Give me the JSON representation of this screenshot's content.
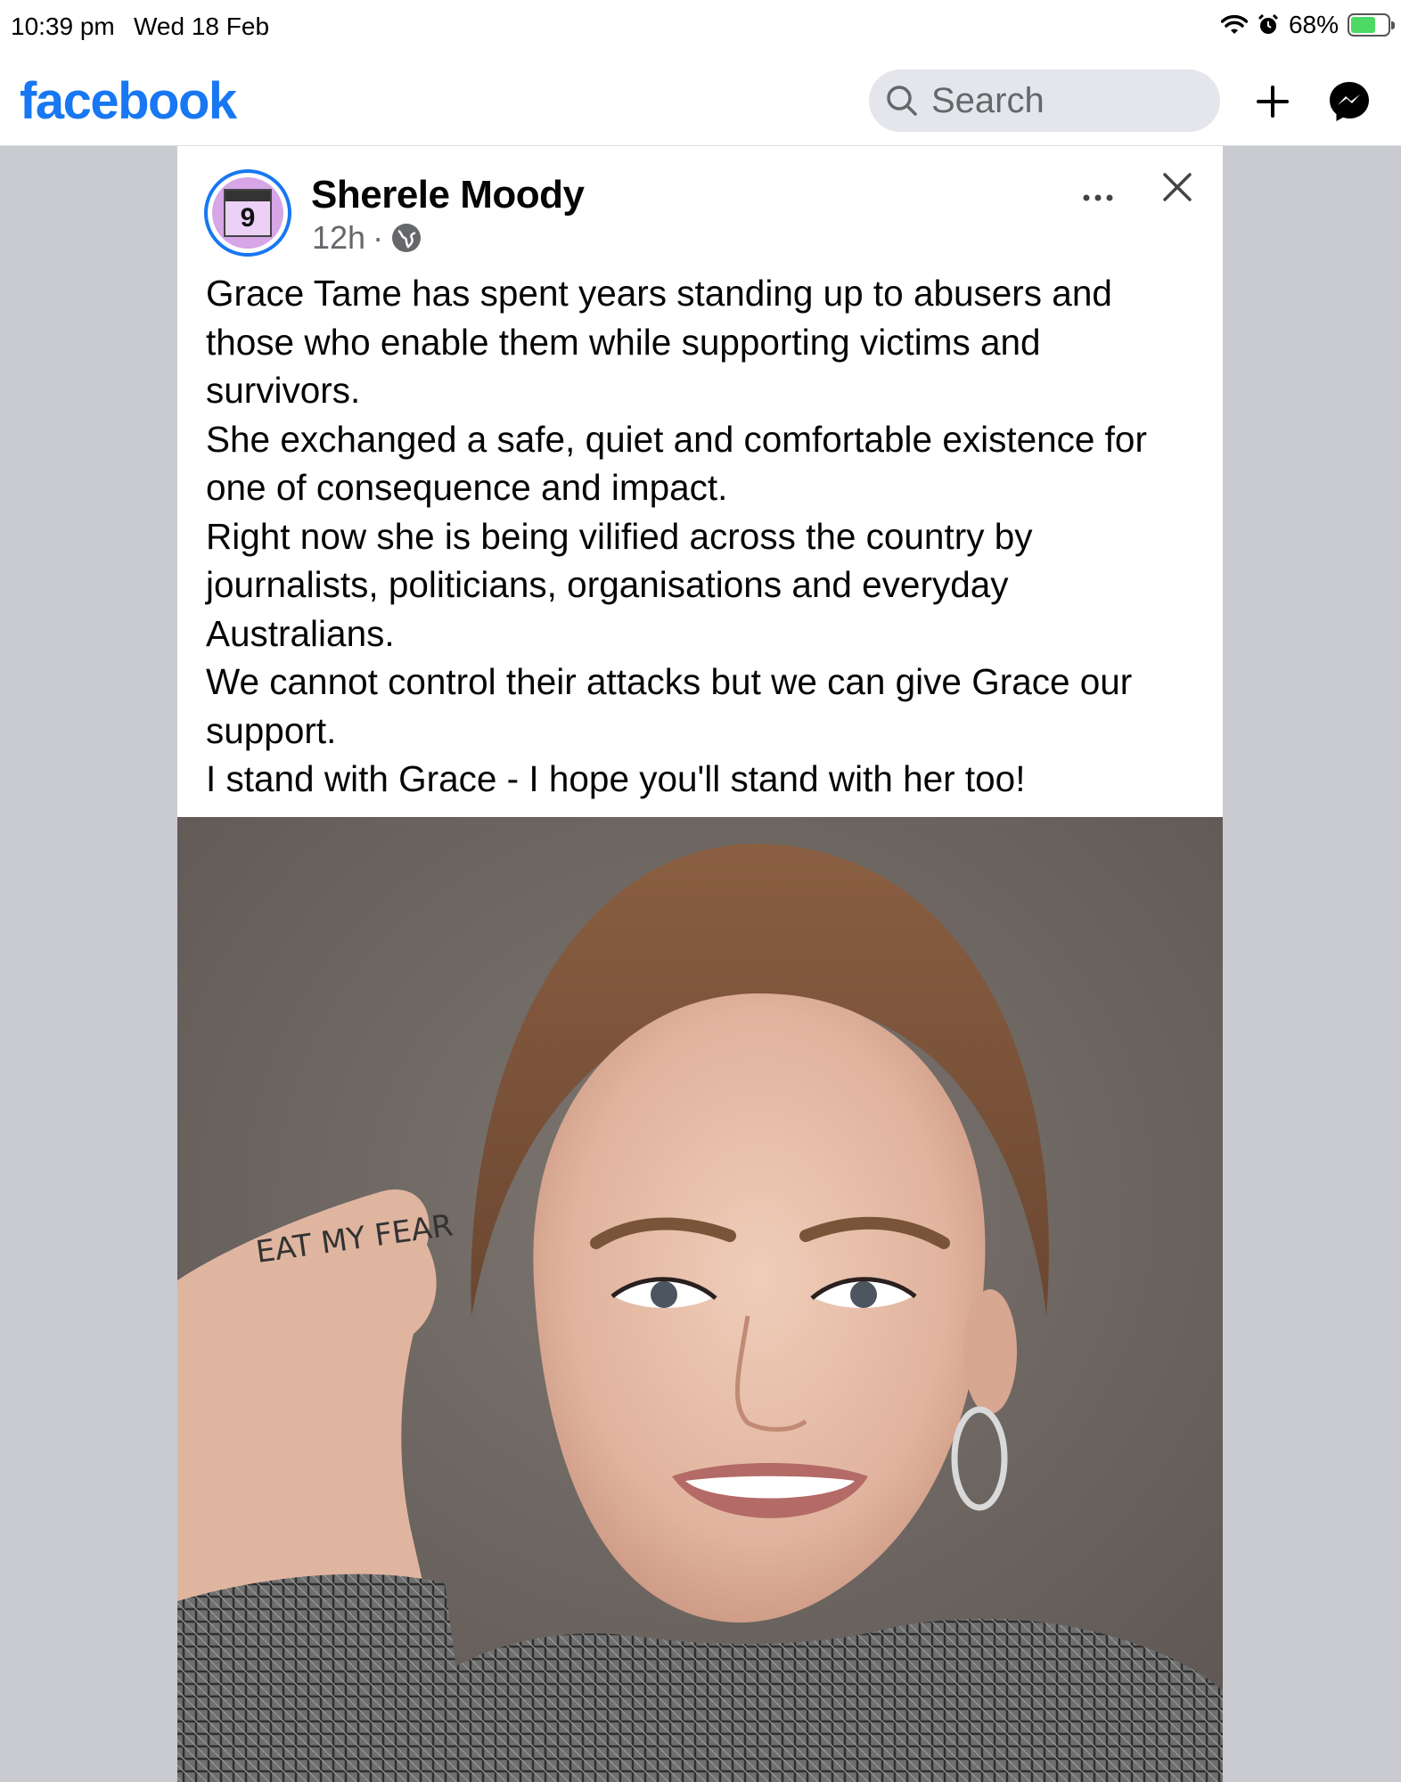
{
  "status_bar": {
    "time": "10:39 pm",
    "date": "Wed 18 Feb",
    "battery": "68%",
    "battery_level": 0.68
  },
  "header": {
    "logo": "facebook",
    "search_placeholder": "Search",
    "icons": [
      "search-icon",
      "plus-icon",
      "messenger-icon"
    ]
  },
  "post": {
    "author": "Sherele Moody",
    "time": "12h",
    "separator": "·",
    "avatar_number": "9",
    "text": "Grace Tame has spent years standing up to abusers and those who enable them while supporting victims and survivors.\nShe exchanged a safe, quiet and comfortable existence for one of consequence and impact.\nRight now she is being vilified across the country by journalists, politicians, organisations and everyday Australians.\nWe cannot control their attacks but we can give Grace our support.\nI stand with Grace  - I hope you'll stand with her too!",
    "photo_hand_text": "EAT MY FEAR"
  },
  "colors": {
    "brand": "#1877f2",
    "background": "#c9cbd1",
    "secondary_text": "#65676b"
  }
}
